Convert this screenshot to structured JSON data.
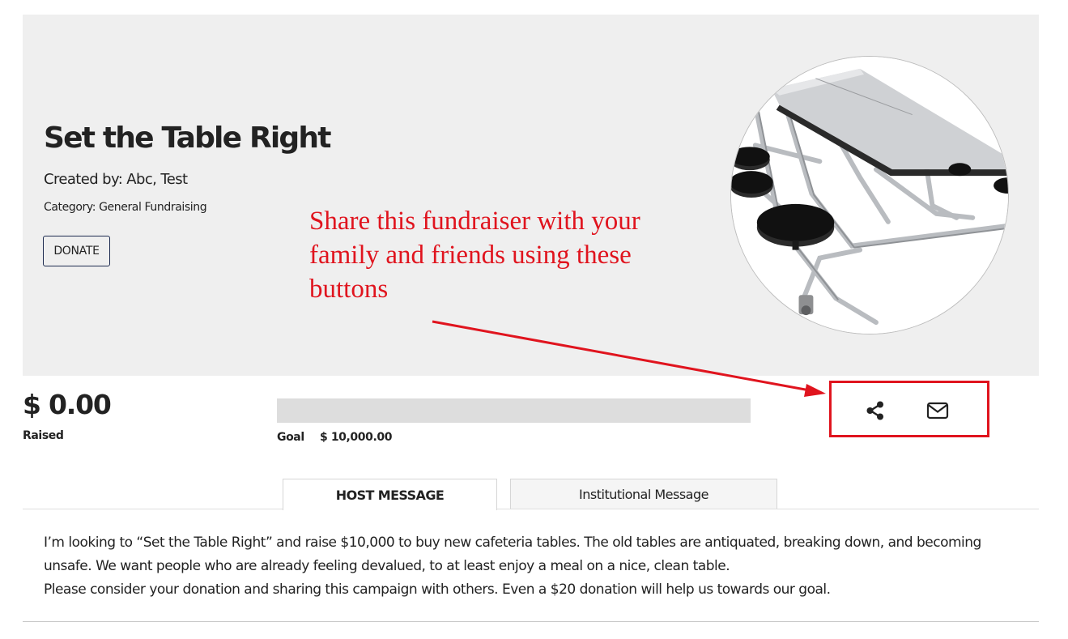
{
  "campaign": {
    "title": "Set the Table Right",
    "created_by": "Created by: Abc, Test",
    "category": "Category: General Fundraising",
    "donate_label": "DONATE"
  },
  "annotation": {
    "text": "Share this fundraiser with your family and friends using these buttons",
    "color": "#e0141e"
  },
  "stats": {
    "raised_amount": "$ 0.00",
    "raised_label": "Raised",
    "goal_label": "Goal",
    "goal_value": "$ 10,000.00",
    "progress_fraction": 0
  },
  "share": {
    "share_icon": "share-icon",
    "email_icon": "email-icon"
  },
  "tabs": [
    {
      "label": "HOST MESSAGE",
      "active": true
    },
    {
      "label": "Institutional Message",
      "active": false
    }
  ],
  "message": {
    "paragraphs": [
      "I’m looking to “Set the Table Right” and raise $10,000 to buy new cafeteria tables. The old tables are antiquated, breaking down, and becoming unsafe. We want people who are already feeling devalued, to at least enjoy a meal on a nice, clean table.",
      "Please consider your donation and sharing this campaign with others. Even a $20 donation will help us towards our goal."
    ]
  },
  "colors": {
    "hero_background": "#efefef",
    "button_border": "#1d2b50",
    "highlight_red": "#e0141e"
  }
}
